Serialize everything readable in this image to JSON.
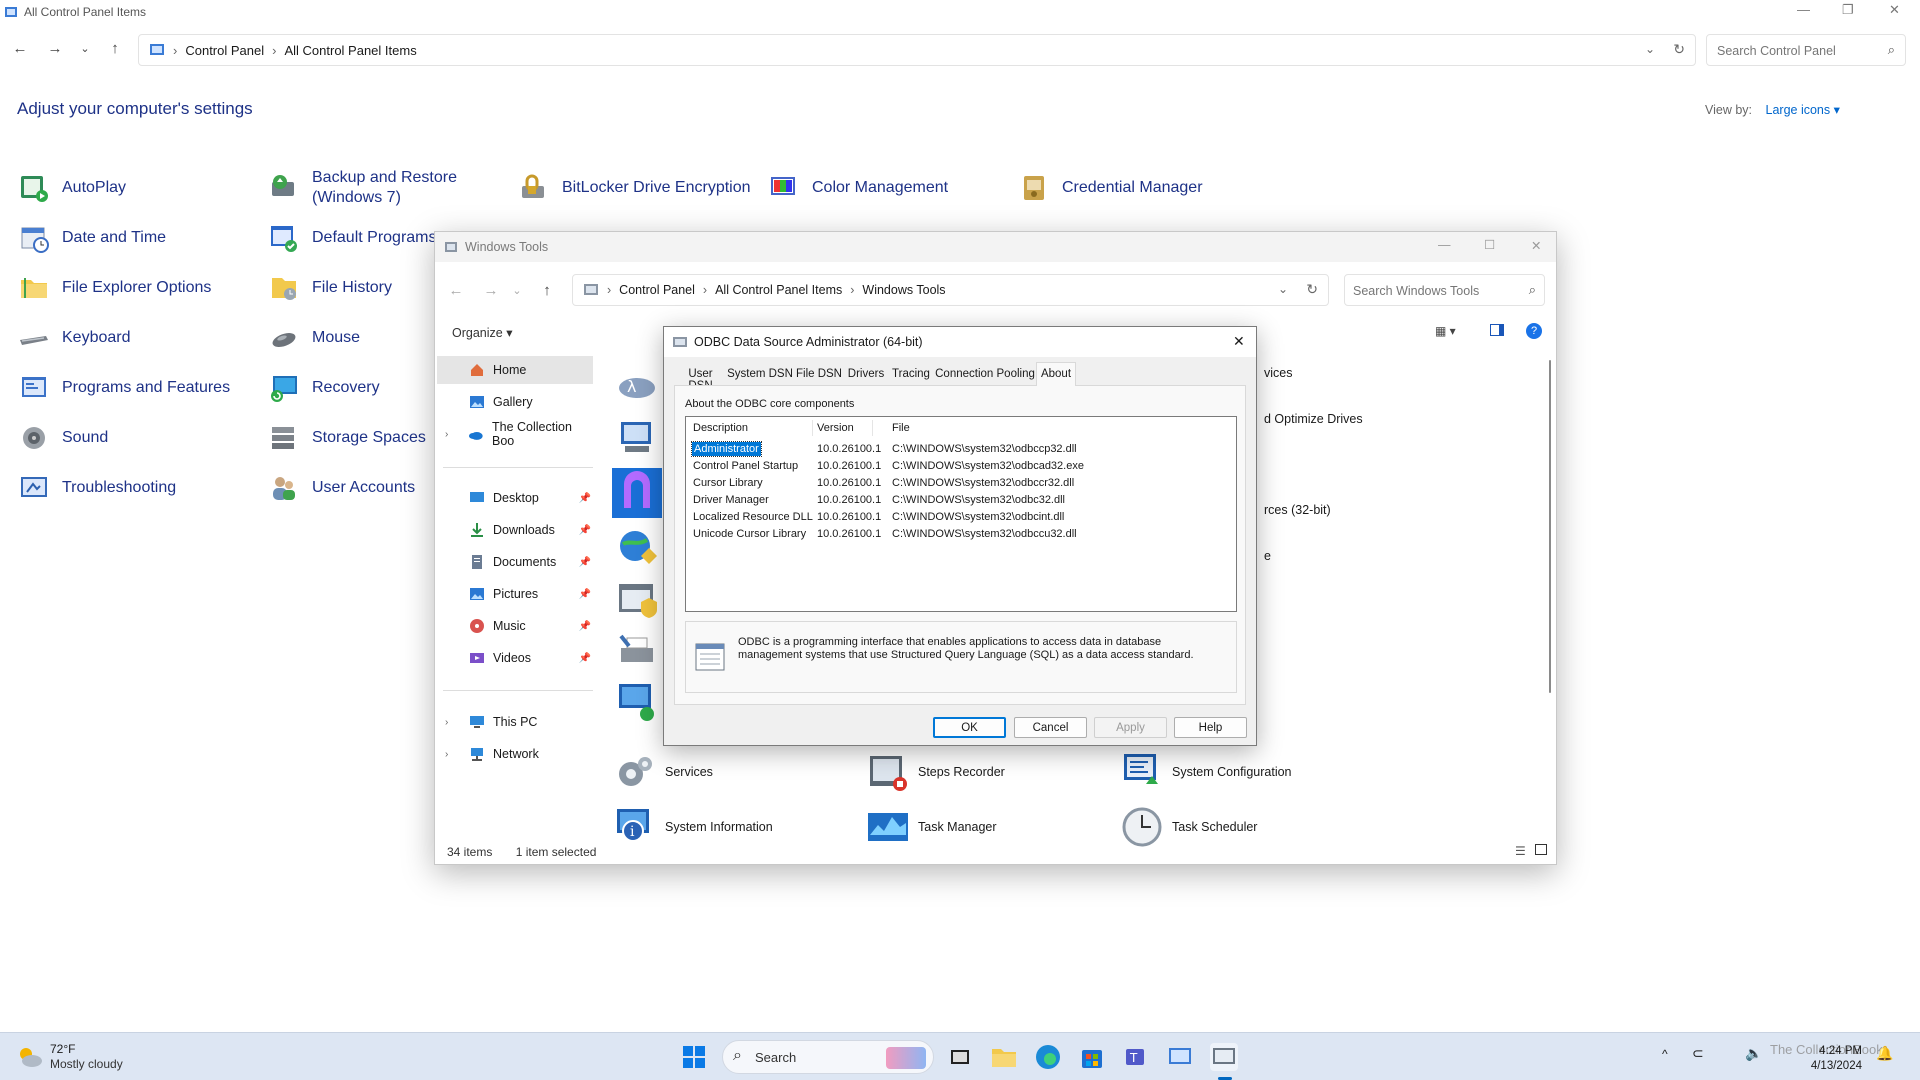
{
  "control_panel": {
    "window_title": "All Control Panel Items",
    "breadcrumb": [
      "Control Panel",
      "All Control Panel Items"
    ],
    "search_placeholder": "Search Control Panel",
    "heading": "Adjust your computer's settings",
    "view_by_label": "View by:",
    "view_by_value": "Large icons",
    "items": [
      {
        "label": "AutoPlay",
        "icon": "autoplay-icon"
      },
      {
        "label": "Backup and Restore (Windows 7)",
        "icon": "backup-icon"
      },
      {
        "label": "BitLocker Drive Encryption",
        "icon": "bitlocker-icon"
      },
      {
        "label": "Color Management",
        "icon": "color-management-icon"
      },
      {
        "label": "Credential Manager",
        "icon": "credential-manager-icon"
      },
      {
        "label": "Date and Time",
        "icon": "date-time-icon"
      },
      {
        "label": "Default Programs",
        "icon": "default-programs-icon"
      },
      {
        "label": "File Explorer Options",
        "icon": "folder-options-icon"
      },
      {
        "label": "File History",
        "icon": "file-history-icon"
      },
      {
        "label": "Keyboard",
        "icon": "keyboard-icon"
      },
      {
        "label": "Mouse",
        "icon": "mouse-icon"
      },
      {
        "label": "Programs and Features",
        "icon": "programs-icon"
      },
      {
        "label": "Recovery",
        "icon": "recovery-icon"
      },
      {
        "label": "Sound",
        "icon": "sound-icon"
      },
      {
        "label": "Storage Spaces",
        "icon": "storage-spaces-icon"
      },
      {
        "label": "Troubleshooting",
        "icon": "troubleshooting-icon"
      },
      {
        "label": "User Accounts",
        "icon": "user-accounts-icon"
      }
    ]
  },
  "windows_tools": {
    "window_title": "Windows Tools",
    "breadcrumb": [
      "Control Panel",
      "All Control Panel Items",
      "Windows Tools"
    ],
    "search_placeholder": "Search Windows Tools",
    "organize_label": "Organize",
    "nav": [
      {
        "label": "Home",
        "icon": "home-icon"
      },
      {
        "label": "Gallery",
        "icon": "gallery-icon"
      },
      {
        "label": "The Collection Boo",
        "icon": "onedrive-icon"
      },
      {
        "label": "Desktop",
        "icon": "desktop-icon"
      },
      {
        "label": "Downloads",
        "icon": "downloads-icon"
      },
      {
        "label": "Documents",
        "icon": "documents-icon"
      },
      {
        "label": "Pictures",
        "icon": "pictures-icon"
      },
      {
        "label": "Music",
        "icon": "music-icon"
      },
      {
        "label": "Videos",
        "icon": "videos-icon"
      },
      {
        "label": "This PC",
        "icon": "this-pc-icon"
      },
      {
        "label": "Network",
        "icon": "network-icon"
      }
    ],
    "partial_labels": [
      "vices",
      "d Optimize Drives",
      "rces (32-bit)",
      "e"
    ],
    "grid_items": [
      {
        "label": "Services",
        "icon": "services-icon"
      },
      {
        "label": "Steps Recorder",
        "icon": "steps-recorder-icon"
      },
      {
        "label": "System Configuration",
        "icon": "system-configuration-icon"
      },
      {
        "label": "System Information",
        "icon": "system-information-icon"
      },
      {
        "label": "Task Manager",
        "icon": "task-manager-icon"
      },
      {
        "label": "Task Scheduler",
        "icon": "task-scheduler-icon"
      }
    ],
    "status_items": "34 items",
    "status_selected": "1 item selected"
  },
  "odbc": {
    "title": "ODBC Data Source Administrator (64-bit)",
    "tabs": [
      "User DSN",
      "System DSN",
      "File DSN",
      "Drivers",
      "Tracing",
      "Connection Pooling",
      "About"
    ],
    "active_tab": "About",
    "section_label": "About the ODBC core components",
    "columns": [
      "Description",
      "Version",
      "File"
    ],
    "rows": [
      {
        "description": "Administrator",
        "version": "10.0.26100.1",
        "file": "C:\\WINDOWS\\system32\\odbccp32.dll"
      },
      {
        "description": "Control Panel Startup",
        "version": "10.0.26100.1",
        "file": "C:\\WINDOWS\\system32\\odbcad32.exe"
      },
      {
        "description": "Cursor Library",
        "version": "10.0.26100.1",
        "file": "C:\\WINDOWS\\system32\\odbccr32.dll"
      },
      {
        "description": "Driver Manager",
        "version": "10.0.26100.1",
        "file": "C:\\WINDOWS\\system32\\odbc32.dll"
      },
      {
        "description": "Localized Resource DLL",
        "version": "10.0.26100.1",
        "file": "C:\\WINDOWS\\system32\\odbcint.dll"
      },
      {
        "description": "Unicode Cursor Library",
        "version": "10.0.26100.1",
        "file": "C:\\WINDOWS\\system32\\odbccu32.dll"
      }
    ],
    "info_text": "ODBC is a programming interface that enables applications to access data in database management systems that use Structured Query Language (SQL) as a data access standard.",
    "buttons": {
      "ok": "OK",
      "cancel": "Cancel",
      "apply": "Apply",
      "help": "Help"
    }
  },
  "taskbar": {
    "weather_temp": "72°F",
    "weather_desc": "Mostly cloudy",
    "search_label": "Search",
    "time": "4:24 PM",
    "date": "4/13/2024",
    "watermark": "The CollectionBook"
  },
  "colors": {
    "link_blue": "#1e3287",
    "accent": "#0067c0",
    "selection": "#0078d7"
  }
}
